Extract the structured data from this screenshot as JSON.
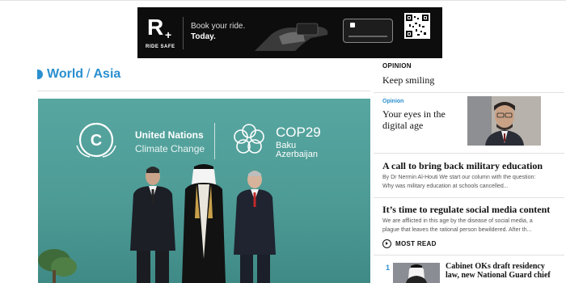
{
  "ad": {
    "brand": "RIDE SAFE",
    "logo_mark": "R",
    "headline": "Book your ride.",
    "subline": "Today."
  },
  "section": {
    "breadcrumb": [
      "World",
      "Asia"
    ],
    "separator": "/"
  },
  "hero": {
    "un_name": "United Nations",
    "un_sub": "Climate Change",
    "cop_name": "COP29",
    "cop_city": "Baku",
    "cop_country": "Azerbaijan"
  },
  "opinion": {
    "label": "OPINION",
    "title": "Keep smiling",
    "featured": {
      "tag": "Opinion",
      "headline": "Your eyes in the digital age"
    }
  },
  "articles": [
    {
      "title": "A call to bring back military education",
      "excerpt": "By Dr Nermin Al-Houti We start our column with the question: Why was military education at schools cancelled..."
    },
    {
      "title": "It’s time to regulate social media content",
      "excerpt": "We are afflicted in this age by the disease of social media, a plague that leaves the rational person bewildered. After th..."
    }
  ],
  "most_read": {
    "label": "MOST READ",
    "items": [
      {
        "rank": "1",
        "title": "Cabinet OKs draft residency law, new National Guard chief"
      }
    ]
  },
  "colors": {
    "accent": "#2a8fcf",
    "hero_bg": "#4e9b96",
    "ad_bg": "#0d0d0d"
  }
}
